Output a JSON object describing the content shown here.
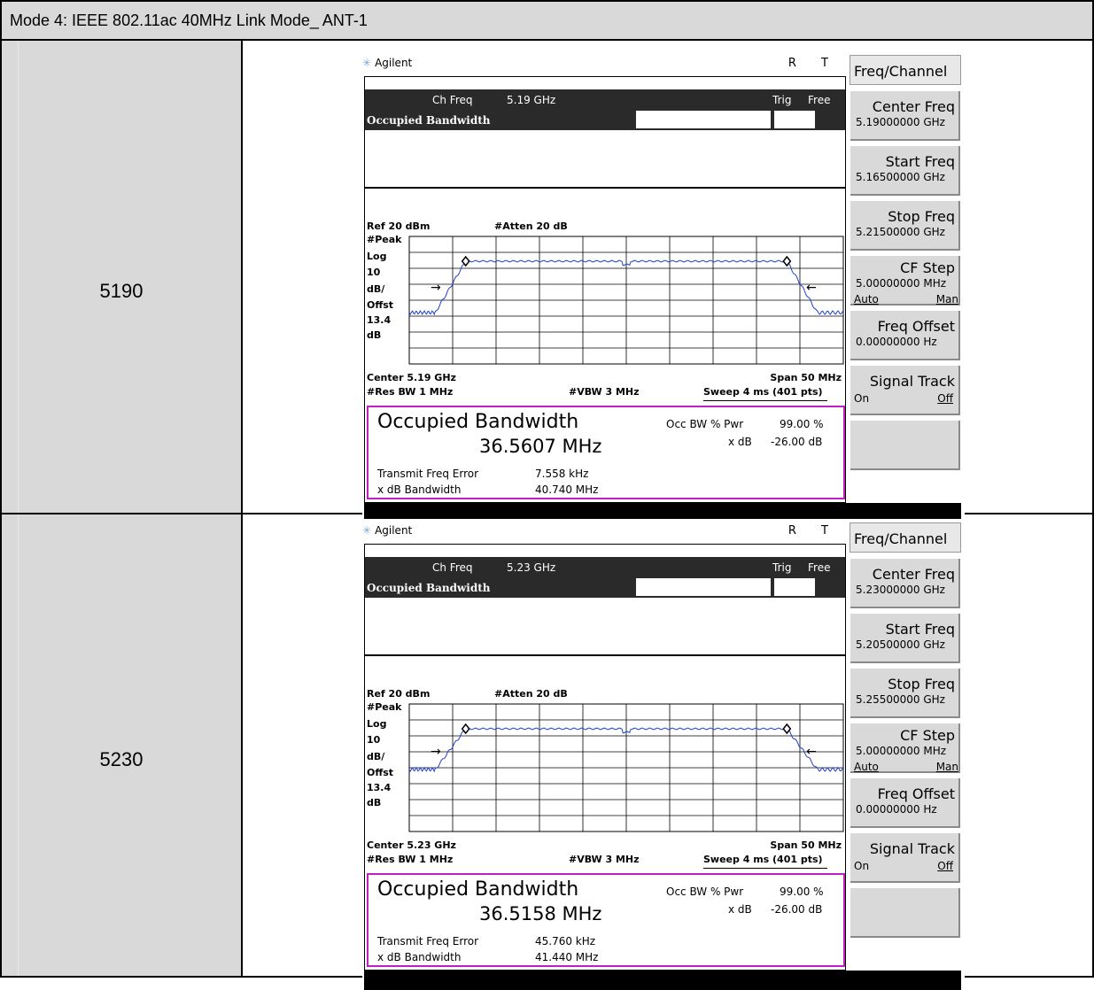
{
  "header": {
    "title": "Mode 4: IEEE 802.11ac 40MHz Link Mode_ ANT-1"
  },
  "rows": [
    {
      "channel": "5190",
      "screen": {
        "brand": "Agilent",
        "rt": "R T",
        "ch_freq_label": "Ch Freq",
        "ch_freq_value": "5.19 GHz",
        "trig": "Trig",
        "free": "Free",
        "mode_title": "Occupied Bandwidth",
        "ref": "Ref 20 dBm",
        "atten": "#Atten 20 dB",
        "left_labels": [
          "#Peak",
          "Log",
          "10",
          "dB/",
          "Offst",
          "13.4",
          "dB"
        ],
        "center": "Center 5.19 GHz",
        "span": "Span 50 MHz",
        "res_bw": "#Res BW 1 MHz",
        "vbw": "#VBW 3 MHz",
        "sweep": "Sweep 4 ms (401 pts)",
        "obw_title": "Occupied Bandwidth",
        "obw_value": "36.5607 MHz",
        "occ_bw_label": "Occ BW % Pwr",
        "occ_bw_value": "99.00 %",
        "xdb_label": "x dB",
        "xdb_value": "-26.00 dB",
        "tfe_label": "Transmit Freq Error",
        "tfe_value": "7.558 kHz",
        "xdbbw_label": "x dB Bandwidth",
        "xdbbw_value": "40.740 MHz",
        "softkeys": {
          "menu": "Freq/Channel",
          "center_freq": "Center Freq",
          "center_freq_val": "5.19000000 GHz",
          "start_freq": "Start Freq",
          "start_freq_val": "5.16500000 GHz",
          "stop_freq": "Stop Freq",
          "stop_freq_val": "5.21500000 GHz",
          "cf_step": "CF Step",
          "cf_step_val": "5.00000000 MHz",
          "auto": "Auto",
          "man": "Man",
          "freq_offset": "Freq Offset",
          "freq_offset_val": "0.00000000  Hz",
          "signal_track": "Signal Track",
          "on": "On",
          "off": "Off"
        }
      }
    },
    {
      "channel": "5230",
      "screen": {
        "brand": "Agilent",
        "rt": "R T",
        "ch_freq_label": "Ch Freq",
        "ch_freq_value": "5.23 GHz",
        "trig": "Trig",
        "free": "Free",
        "mode_title": "Occupied Bandwidth",
        "ref": "Ref 20 dBm",
        "atten": "#Atten 20 dB",
        "left_labels": [
          "#Peak",
          "Log",
          "10",
          "dB/",
          "Offst",
          "13.4",
          "dB"
        ],
        "center": "Center 5.23 GHz",
        "span": "Span 50 MHz",
        "res_bw": "#Res BW 1 MHz",
        "vbw": "#VBW 3 MHz",
        "sweep": "Sweep 4 ms (401 pts)",
        "obw_title": "Occupied Bandwidth",
        "obw_value": "36.5158 MHz",
        "occ_bw_label": "Occ BW % Pwr",
        "occ_bw_value": "99.00 %",
        "xdb_label": "x dB",
        "xdb_value": "-26.00 dB",
        "tfe_label": "Transmit Freq Error",
        "tfe_value": "45.760 kHz",
        "xdbbw_label": "x dB Bandwidth",
        "xdbbw_value": "41.440 MHz",
        "softkeys": {
          "menu": "Freq/Channel",
          "center_freq": "Center Freq",
          "center_freq_val": "5.23000000 GHz",
          "start_freq": "Start Freq",
          "start_freq_val": "5.20500000 GHz",
          "stop_freq": "Stop Freq",
          "stop_freq_val": "5.25500000 GHz",
          "cf_step": "CF Step",
          "cf_step_val": "5.00000000 MHz",
          "auto": "Auto",
          "man": "Man",
          "freq_offset": "Freq Offset",
          "freq_offset_val": "0.00000000  Hz",
          "signal_track": "Signal Track",
          "on": "On",
          "off": "Off"
        }
      }
    }
  ],
  "colors": {
    "trace": "#1f3fd0",
    "obw_frame": "#c020c0",
    "label_bg": "#d9d9d9"
  }
}
